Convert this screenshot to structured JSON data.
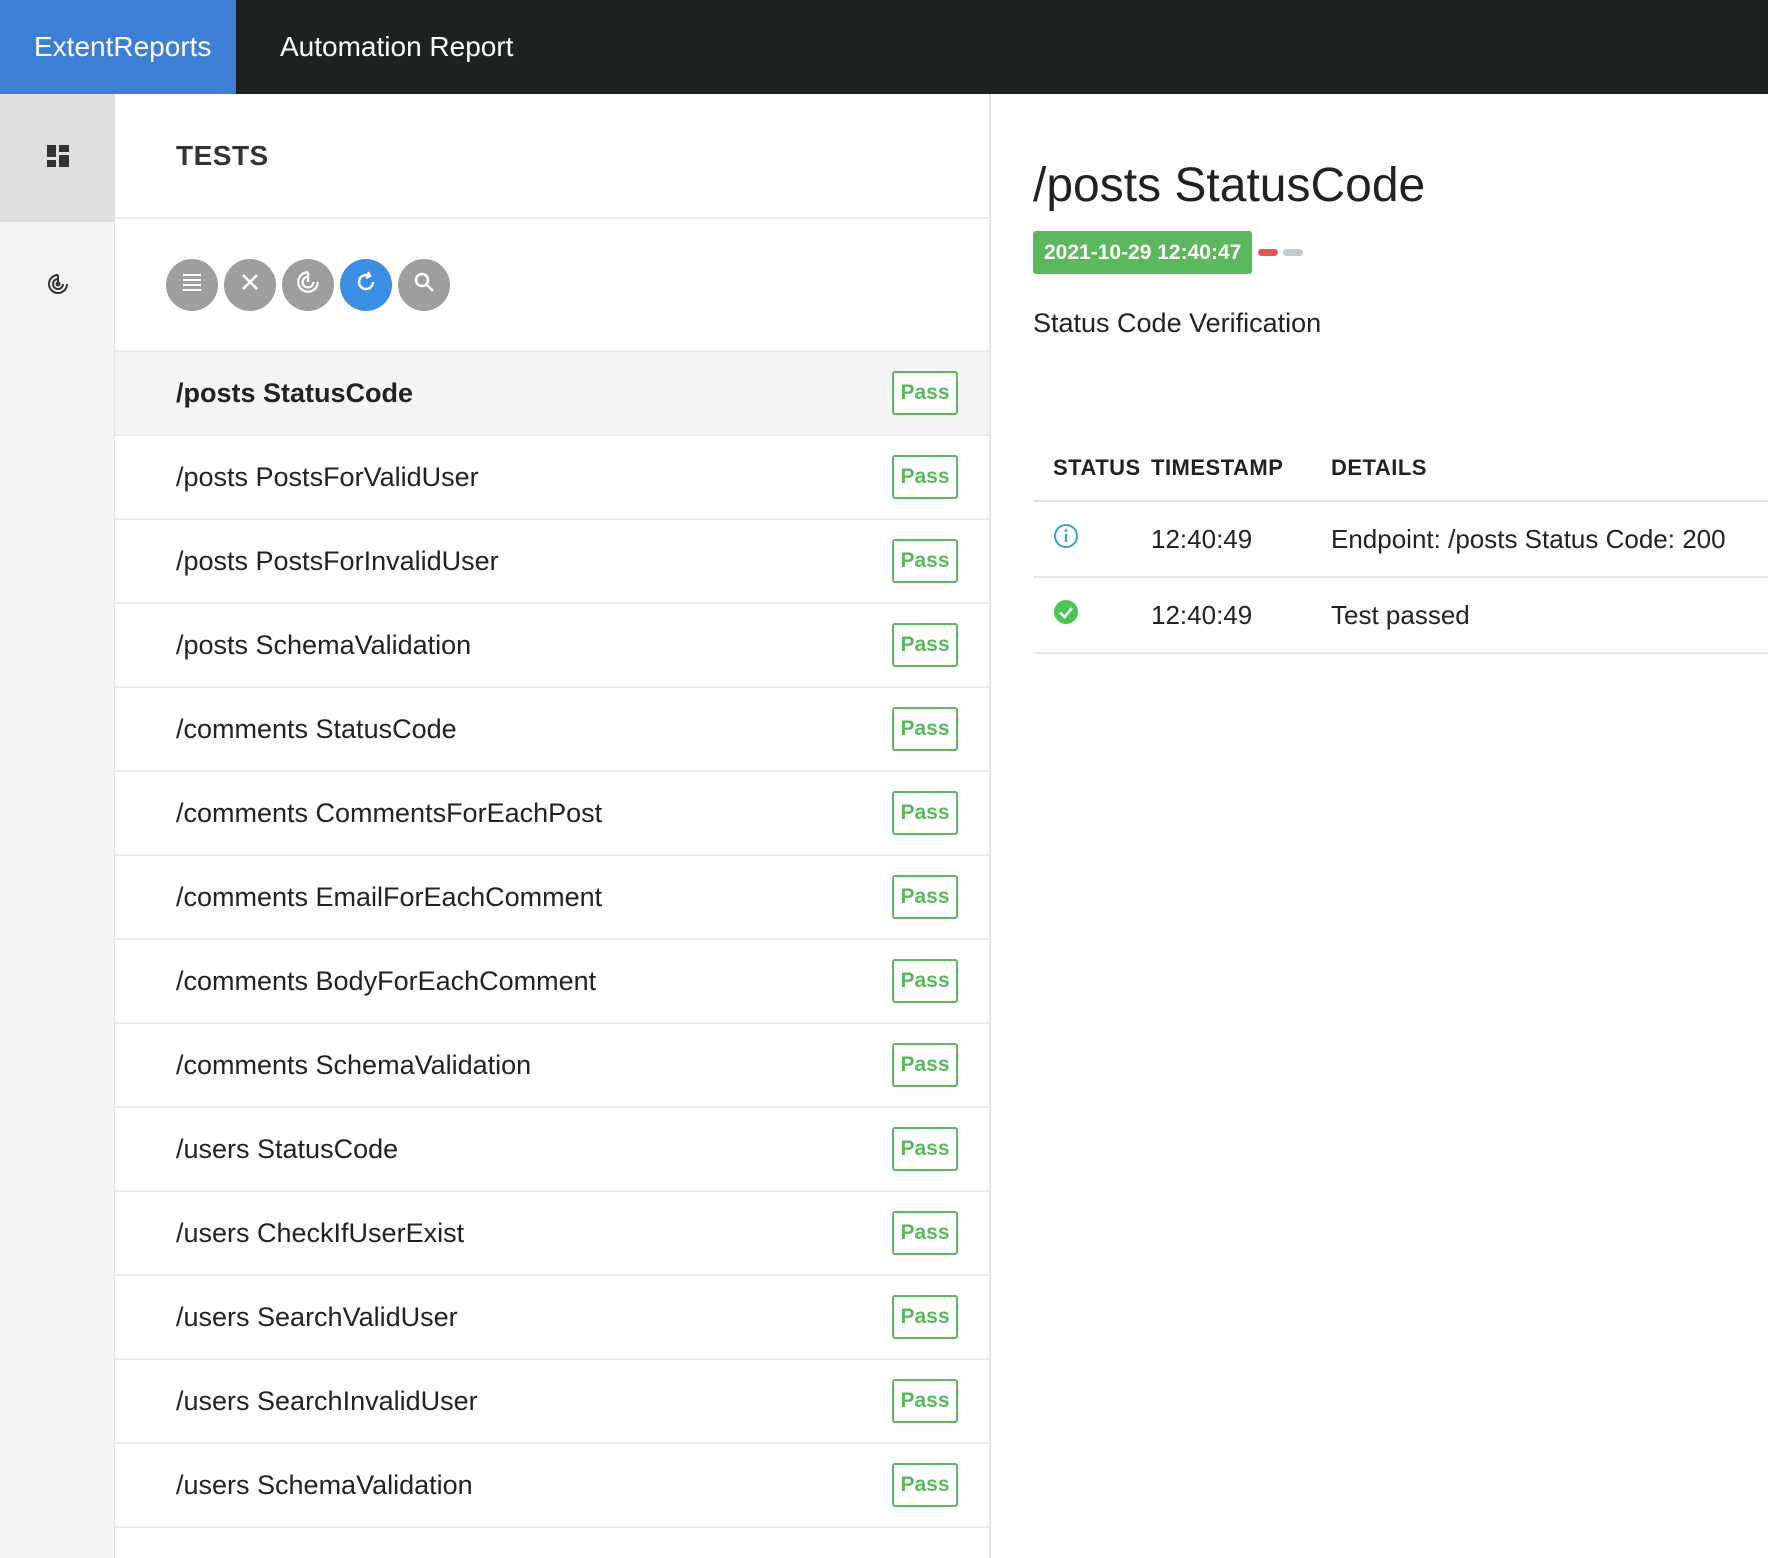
{
  "header": {
    "brand": "ExtentReports",
    "title": "Automation Report",
    "brand_color": "#3c7fd4",
    "bar_color": "#1e2320"
  },
  "sidebar": {
    "items": [
      {
        "icon": "dashboard-icon",
        "active": true
      },
      {
        "icon": "radar-icon",
        "active": false
      }
    ]
  },
  "tests_panel": {
    "title": "TESTS",
    "toolbar": [
      {
        "icon": "list-icon"
      },
      {
        "icon": "close-icon"
      },
      {
        "icon": "radar-icon"
      },
      {
        "icon": "refresh-icon",
        "active": true
      },
      {
        "icon": "search-icon"
      }
    ],
    "tests": [
      {
        "name": "/posts StatusCode",
        "status": "Pass",
        "selected": true
      },
      {
        "name": "/posts PostsForValidUser",
        "status": "Pass"
      },
      {
        "name": "/posts PostsForInvalidUser",
        "status": "Pass"
      },
      {
        "name": "/posts SchemaValidation",
        "status": "Pass"
      },
      {
        "name": "/comments StatusCode",
        "status": "Pass"
      },
      {
        "name": "/comments CommentsForEachPost",
        "status": "Pass"
      },
      {
        "name": "/comments EmailForEachComment",
        "status": "Pass"
      },
      {
        "name": "/comments BodyForEachComment",
        "status": "Pass"
      },
      {
        "name": "/comments SchemaValidation",
        "status": "Pass"
      },
      {
        "name": "/users StatusCode",
        "status": "Pass"
      },
      {
        "name": "/users CheckIfUserExist",
        "status": "Pass"
      },
      {
        "name": "/users SearchValidUser",
        "status": "Pass"
      },
      {
        "name": "/users SearchInvalidUser",
        "status": "Pass"
      },
      {
        "name": "/users SchemaValidation",
        "status": "Pass"
      }
    ],
    "pass_color": "#5cb85c"
  },
  "detail": {
    "title": "/posts StatusCode",
    "start_time": "2021-10-29 12:40:47",
    "description": "Status Code Verification",
    "columns": [
      "STATUS",
      "TIMESTAMP",
      "DETAILS"
    ],
    "logs": [
      {
        "status_icon": "info-icon",
        "timestamp": "12:40:49",
        "details": "Endpoint: /posts Status Code: 200"
      },
      {
        "status_icon": "check-circle-icon",
        "timestamp": "12:40:49",
        "details": "Test passed"
      }
    ]
  }
}
